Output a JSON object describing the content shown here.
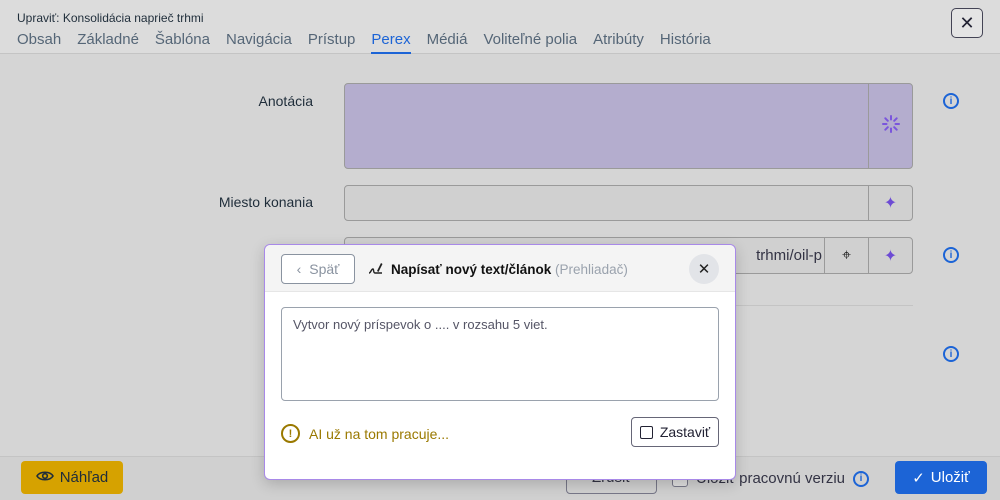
{
  "header": {
    "title": "Upraviť: Konsolidácia naprieč trhmi",
    "tabs": [
      "Obsah",
      "Základné",
      "Šablóna",
      "Navigácia",
      "Prístup",
      "Perex",
      "Médiá",
      "Voliteľné polia",
      "Atribúty",
      "História"
    ],
    "active_tab": "Perex",
    "close_symbol": "✕"
  },
  "form": {
    "annotation_label": "Anotácia",
    "location_label": "Miesto konania",
    "third_field_value": "trhmi/oil-p",
    "accent_color": "#b4adce"
  },
  "footer": {
    "preview_label": "Náhľad",
    "cancel_label": "Zrušiť",
    "save_working_label": "Uložiť pracovnú verziu",
    "save_label": "Uložiť"
  },
  "dialog": {
    "back_label": "Späť",
    "title": "Napísať nový text/článok",
    "subtitle": "(Prehliadač)",
    "close_symbol": "✕",
    "prompt_text": "Vytvor nový príspevok o .... v rozsahu 5 viet.",
    "status_text": "AI už na tom pracuje...",
    "stop_label": "Zastaviť",
    "status_color": "#9a7900",
    "border_color": "#a889e8"
  },
  "icons": {
    "info": "i",
    "warn": "!"
  }
}
